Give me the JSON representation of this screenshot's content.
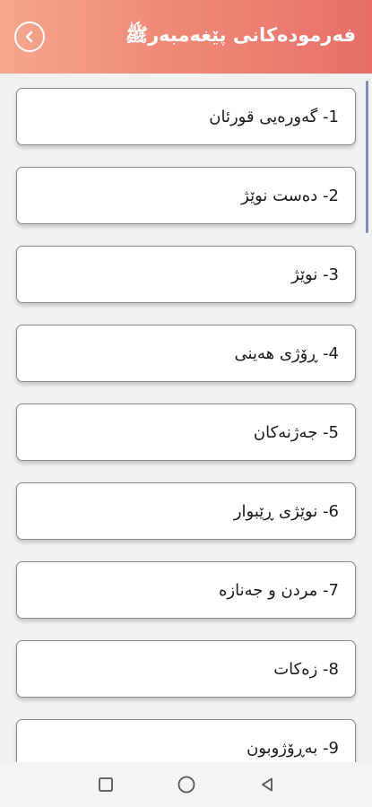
{
  "header": {
    "title": "فەرمودەکانی پێغەمبەرﷺ",
    "back_icon": "chevron-left-circle-icon",
    "gradient": [
      "#f6a78d",
      "#e86f6a"
    ]
  },
  "items": [
    {
      "label": "1- گەورەیی قورئان"
    },
    {
      "label": "2- دەست نوێژ"
    },
    {
      "label": "3- نوێژ"
    },
    {
      "label": "4- ڕۆژی هەینی"
    },
    {
      "label": "5- جەژنەکان"
    },
    {
      "label": "6- نوێژی ڕێبوار"
    },
    {
      "label": "7- مردن و جەنازە"
    },
    {
      "label": "8- زەکات"
    },
    {
      "label": "9- بەڕۆژوبون"
    }
  ],
  "nav": {
    "recents_icon": "square-icon",
    "home_icon": "circle-icon",
    "back_icon": "triangle-back-icon"
  }
}
